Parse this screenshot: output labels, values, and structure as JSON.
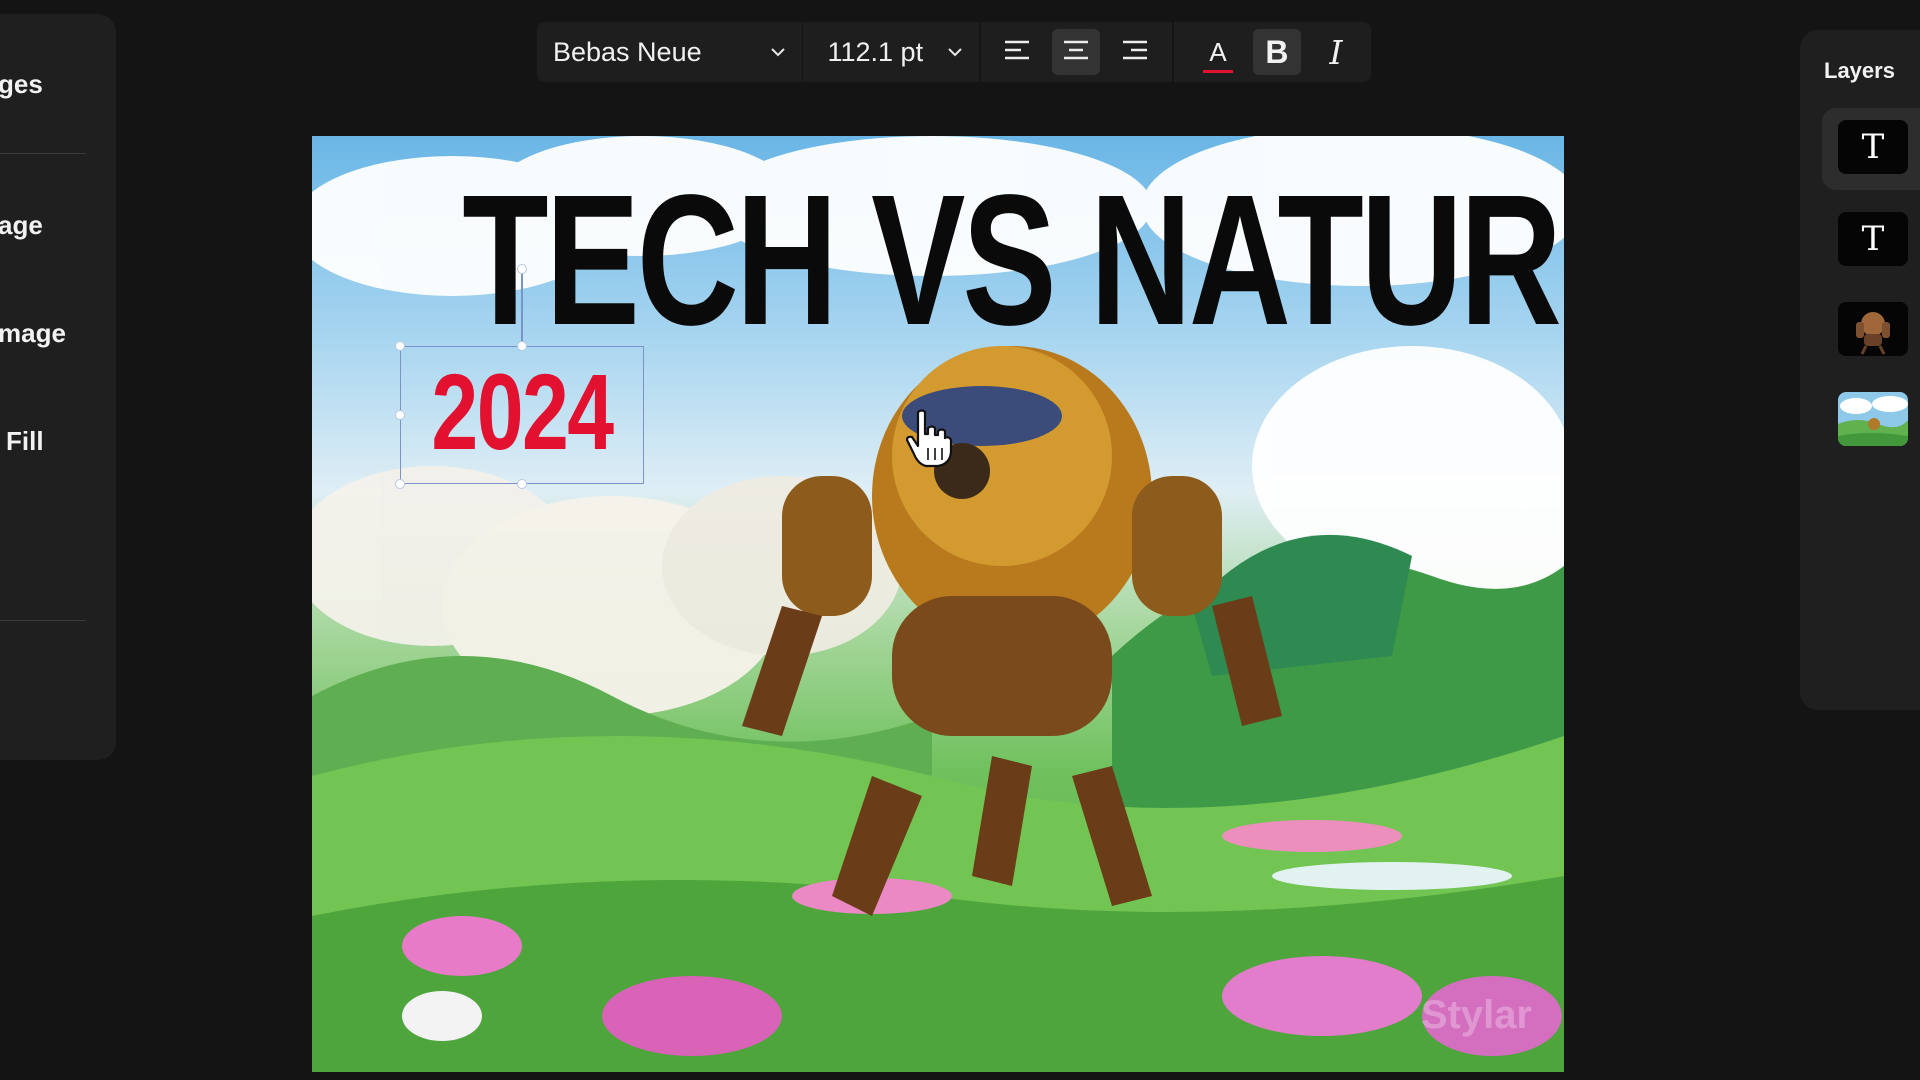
{
  "left_panel": {
    "items": [
      {
        "label": "ges"
      },
      {
        "label": "age"
      },
      {
        "label": "mage"
      },
      {
        "label": "Fill"
      }
    ]
  },
  "toolbar": {
    "font_family": "Bebas Neue",
    "font_size": "112.1 pt",
    "align_left_icon": "align-left-icon",
    "align_center_icon": "align-center-icon",
    "align_right_icon": "align-right-icon",
    "text_color_glyph": "A",
    "text_color": "#e1112f",
    "bold_glyph": "B",
    "italic_glyph": "I",
    "active_alignment": "center"
  },
  "canvas": {
    "headline": "TECH VS NATURE",
    "year": "2024",
    "watermark": "Stylar"
  },
  "layers_panel": {
    "title": "Layers",
    "layers": [
      {
        "type": "text",
        "glyph": "T",
        "selected": true
      },
      {
        "type": "text",
        "glyph": "T",
        "selected": false
      },
      {
        "type": "image",
        "content": "robot",
        "selected": false
      },
      {
        "type": "image",
        "content": "landscape",
        "selected": false
      }
    ]
  },
  "colors": {
    "background": "#141414",
    "panel": "#1f1f1f",
    "accent_red": "#e1112f",
    "selection_blue": "#7b93c9"
  }
}
